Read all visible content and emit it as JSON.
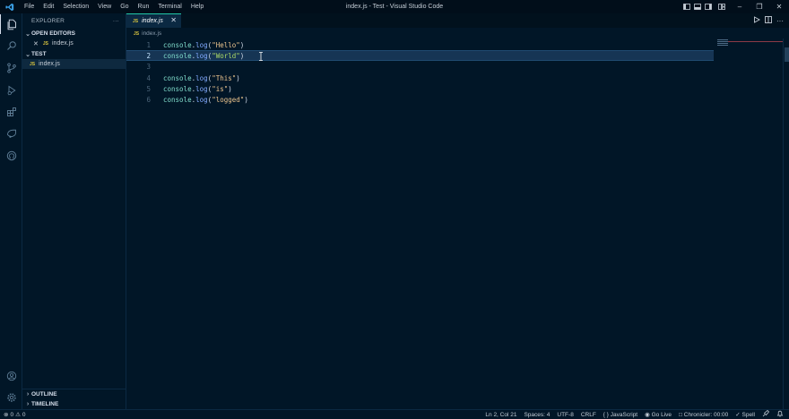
{
  "window": {
    "title": "index.js - Test - Visual Studio Code",
    "menu": [
      "File",
      "Edit",
      "Selection",
      "View",
      "Go",
      "Run",
      "Terminal",
      "Help"
    ],
    "controls": [
      "–",
      "❐",
      "✕"
    ]
  },
  "activity_bar": {
    "items": [
      "explorer-icon",
      "search-icon",
      "source-control-icon",
      "run-debug-icon",
      "extensions-icon",
      "remote-explorer-icon",
      "github-icon"
    ],
    "bottom": [
      "account-icon",
      "manage-gear-icon"
    ]
  },
  "sidebar": {
    "title": "EXPLORER",
    "more": "···",
    "open_editors": {
      "label": "OPEN EDITORS",
      "files": [
        {
          "badge": "JS",
          "name": "index.js"
        }
      ]
    },
    "folder": {
      "label": "TEST",
      "files": [
        {
          "badge": "JS",
          "name": "index.js"
        }
      ]
    },
    "outline_label": "OUTLINE",
    "timeline_label": "TIMELINE"
  },
  "tabs": [
    {
      "badge": "JS",
      "name": "index.js",
      "close": "✕"
    }
  ],
  "breadcrumb": {
    "badge": "JS",
    "file": "index.js"
  },
  "editor": {
    "lines": [
      {
        "num": "1",
        "obj": "console",
        "dot": ".",
        "fn": "log",
        "open": "(",
        "str": "\"Hello\"",
        "close": ")"
      },
      {
        "num": "2",
        "obj": "console",
        "dot": ".",
        "fn": "log",
        "open": "(",
        "str": "\"World\"",
        "close": ")"
      },
      {
        "num": "3"
      },
      {
        "num": "4",
        "obj": "console",
        "dot": ".",
        "fn": "log",
        "open": "(",
        "str": "\"This\"",
        "close": ")"
      },
      {
        "num": "5",
        "obj": "console",
        "dot": ".",
        "fn": "log",
        "open": "(",
        "str": "\"is\"",
        "close": ")"
      },
      {
        "num": "6",
        "obj": "console",
        "dot": ".",
        "fn": "log",
        "open": "(",
        "str": "\"logged\"",
        "close": ")"
      }
    ],
    "current_line": 2
  },
  "status": {
    "errors": "0",
    "warnings": "0",
    "position": "Ln 2, Col 21",
    "spaces": "Spaces: 4",
    "encoding": "UTF-8",
    "eol": "CRLF",
    "language_icon": "{ }",
    "language": "JavaScript",
    "golive": "Go Live",
    "chronicler": "Chronicler: 00:00",
    "spell": "Spell"
  },
  "colors": {
    "background": "#011627",
    "accent": "#21c7a8",
    "js_badge": "#d7c33f",
    "string": "#ecc48d",
    "function": "#82aaff",
    "object": "#7fdbca"
  }
}
